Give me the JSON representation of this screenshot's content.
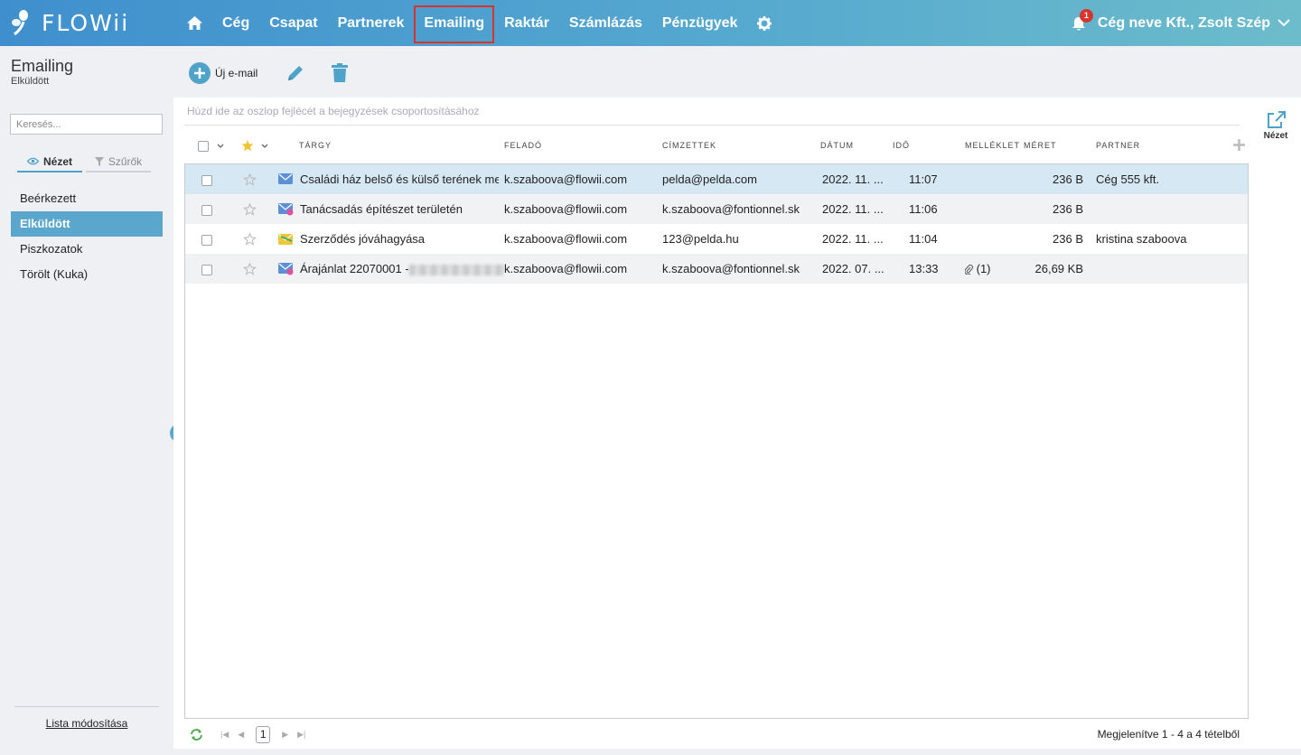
{
  "app": {
    "logo_text": "FLOWii",
    "nav": [
      "Cég",
      "Csapat",
      "Partnerek",
      "Emailing",
      "Raktár",
      "Számlázás",
      "Pénzügyek"
    ],
    "notification_count": "1",
    "user_label": "Cég neve Kft., Zsolt Szép"
  },
  "sidebar": {
    "title": "Emailing",
    "subtitle": "Elküldött",
    "search_placeholder": "Keresés...",
    "tab_view": "Nézet",
    "tab_filters": "Szűrők",
    "folders": [
      "Beérkezett",
      "Elküldött",
      "Piszkozatok",
      "Törölt (Kuka)"
    ],
    "list_edit": "Lista módosítása"
  },
  "toolbar": {
    "new_email": "Új e-mail"
  },
  "grid": {
    "group_hint": "Húzd ide az oszlop fejlécét a bejegyzések csoportosításához",
    "view_label": "Nézet",
    "headers": {
      "subject": "Tárgy",
      "sender": "Feladó",
      "recipients": "Címzettek",
      "date": "Dátum",
      "time": "Idő",
      "attachment": "Melléklet",
      "size": "Méret",
      "partner": "Partner"
    },
    "rows": [
      {
        "subject": "Családi ház belső és külső terének megte",
        "sender": "k.szaboova@flowii.com",
        "recipients": "pelda@pelda.com",
        "date": "2022. 11. ...",
        "time": "11:07",
        "attachment": "",
        "size": "236 B",
        "partner": "Cég 555 kft."
      },
      {
        "subject": "Tanácsadás építészet területén",
        "sender": "k.szaboova@flowii.com",
        "recipients": "k.szaboova@fontionnel.sk",
        "date": "2022. 11. ...",
        "time": "11:06",
        "attachment": "",
        "size": "236 B",
        "partner": ""
      },
      {
        "subject": "Szerződés jóváhagyása",
        "sender": "k.szaboova@flowii.com",
        "recipients": "123@pelda.hu",
        "date": "2022. 11. ...",
        "time": "11:04",
        "attachment": "",
        "size": "236 B",
        "partner": "kristina szaboova"
      },
      {
        "subject": "Árajánlat 22070001 -",
        "sender": "k.szaboova@flowii.com",
        "recipients": "k.szaboova@fontionnel.sk",
        "date": "2022. 07. ...",
        "time": "13:33",
        "attachment": "(1)",
        "size": "26,69 KB",
        "partner": ""
      }
    ],
    "page": "1",
    "status": "Megjelenítve 1 - 4 a 4 tételből"
  },
  "colors": {
    "accent": "#5aa6cc",
    "nav_gradient_start": "#3f8fce",
    "nav_gradient_end": "#6cbccb",
    "active_highlight": "#d9332d",
    "selected_row": "#d6e8f4"
  }
}
